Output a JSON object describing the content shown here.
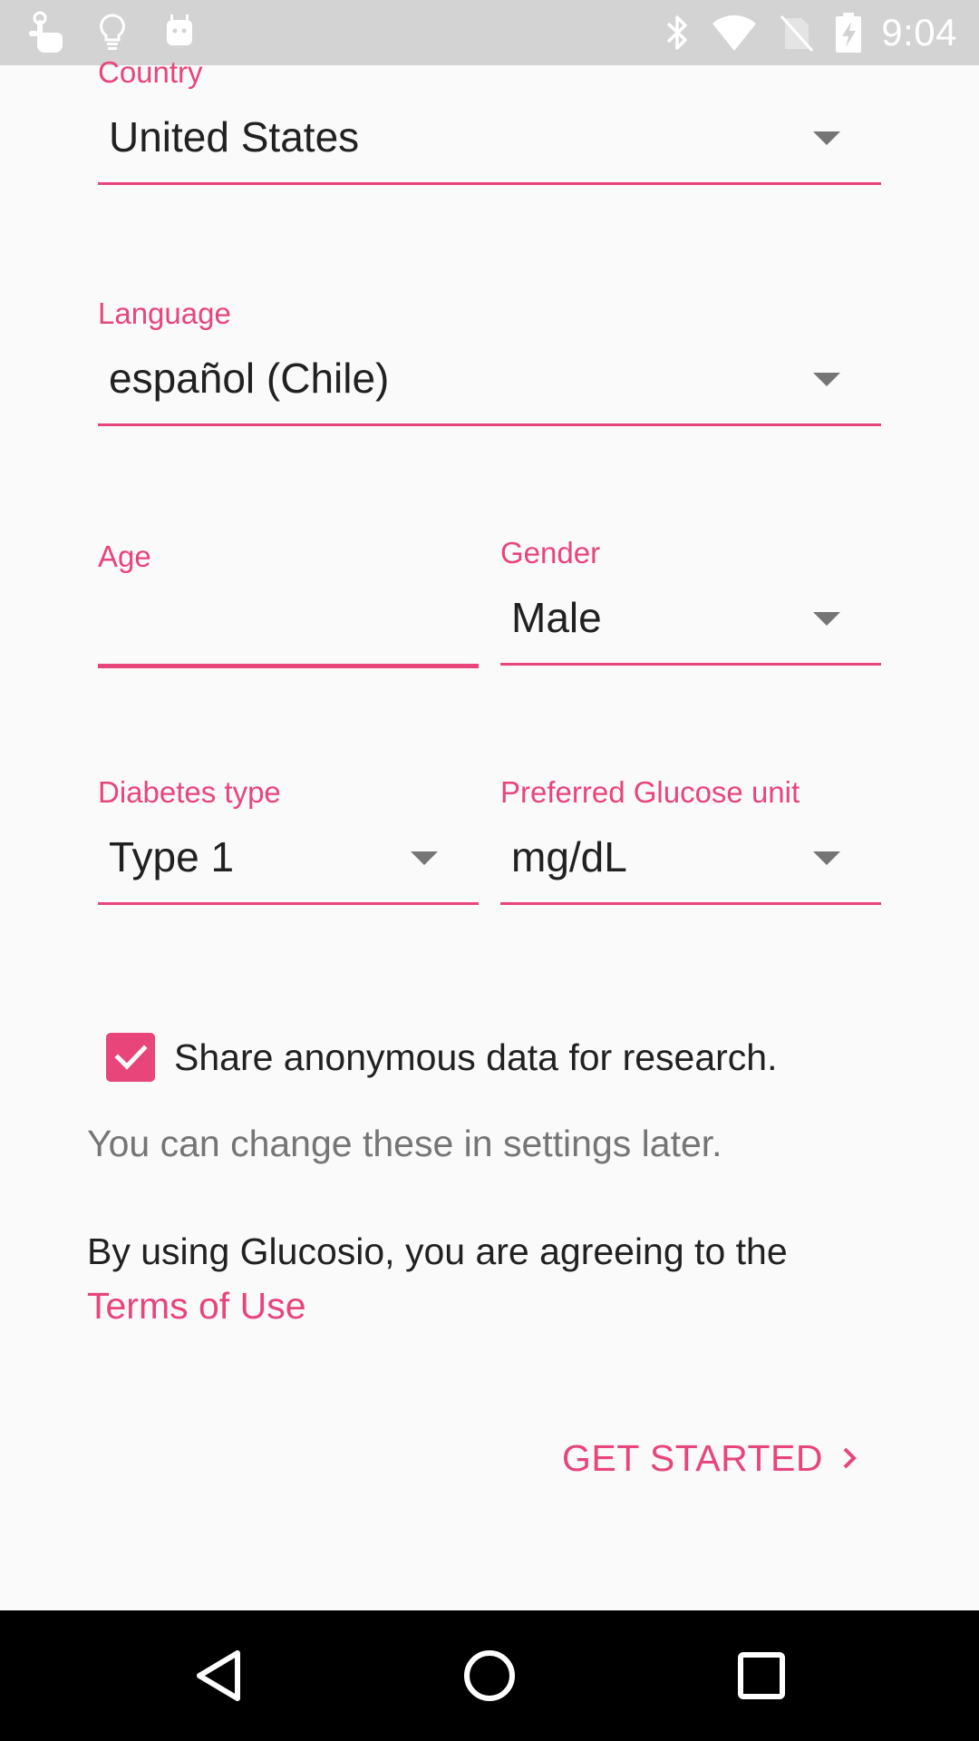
{
  "status_bar": {
    "time": "9:04",
    "left_icons": [
      "touch-gesture-icon",
      "lightbulb-icon",
      "android-icon"
    ],
    "right_icons": [
      "bluetooth-icon",
      "wifi-icon",
      "no-sim-icon",
      "battery-charging-icon"
    ]
  },
  "form": {
    "country": {
      "label": "Country",
      "value": "United States"
    },
    "language": {
      "label": "Language",
      "value": "español (Chile)"
    },
    "age": {
      "label": "Age",
      "value": ""
    },
    "gender": {
      "label": "Gender",
      "value": "Male"
    },
    "diabetes_type": {
      "label": "Diabetes type",
      "value": "Type 1"
    },
    "glucose_unit": {
      "label": "Preferred Glucose unit",
      "value": "mg/dL"
    }
  },
  "share_checkbox": {
    "label": "Share anonymous data for research.",
    "checked": true
  },
  "hint_text": "You can change these in settings later.",
  "terms": {
    "text": "By using Glucosio, you are agreeing to the",
    "link_label": "Terms of Use"
  },
  "get_started_label": "GET STARTED",
  "colors": {
    "accent": "#e8457b",
    "background": "#fafafa",
    "status_bar": "#d3d3d3",
    "nav_bar": "#000000"
  },
  "nav_bar": {
    "buttons": [
      "back-icon",
      "home-icon",
      "recents-icon"
    ]
  }
}
